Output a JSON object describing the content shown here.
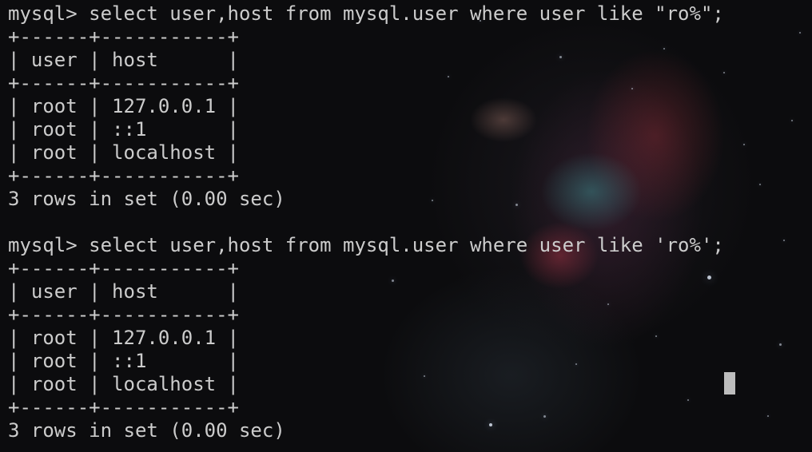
{
  "terminal": {
    "lines": [
      "mysql> select user,host from mysql.user where user like \"ro%\";",
      "+------+-----------+",
      "| user | host      |",
      "+------+-----------+",
      "| root | 127.0.0.1 |",
      "| root | ::1       |",
      "| root | localhost |",
      "+------+-----------+",
      "3 rows in set (0.00 sec)",
      "",
      "mysql> select user,host from mysql.user where user like 'ro%';",
      "+------+-----------+",
      "| user | host      |",
      "+------+-----------+",
      "| root | 127.0.0.1 |",
      "| root | ::1       |",
      "| root | localhost |",
      "+------+-----------+",
      "3 rows in set (0.00 sec)"
    ]
  },
  "colors": {
    "text": "#cccccc",
    "background": "#0c0c0e",
    "cursor": "#bdbdbd"
  }
}
